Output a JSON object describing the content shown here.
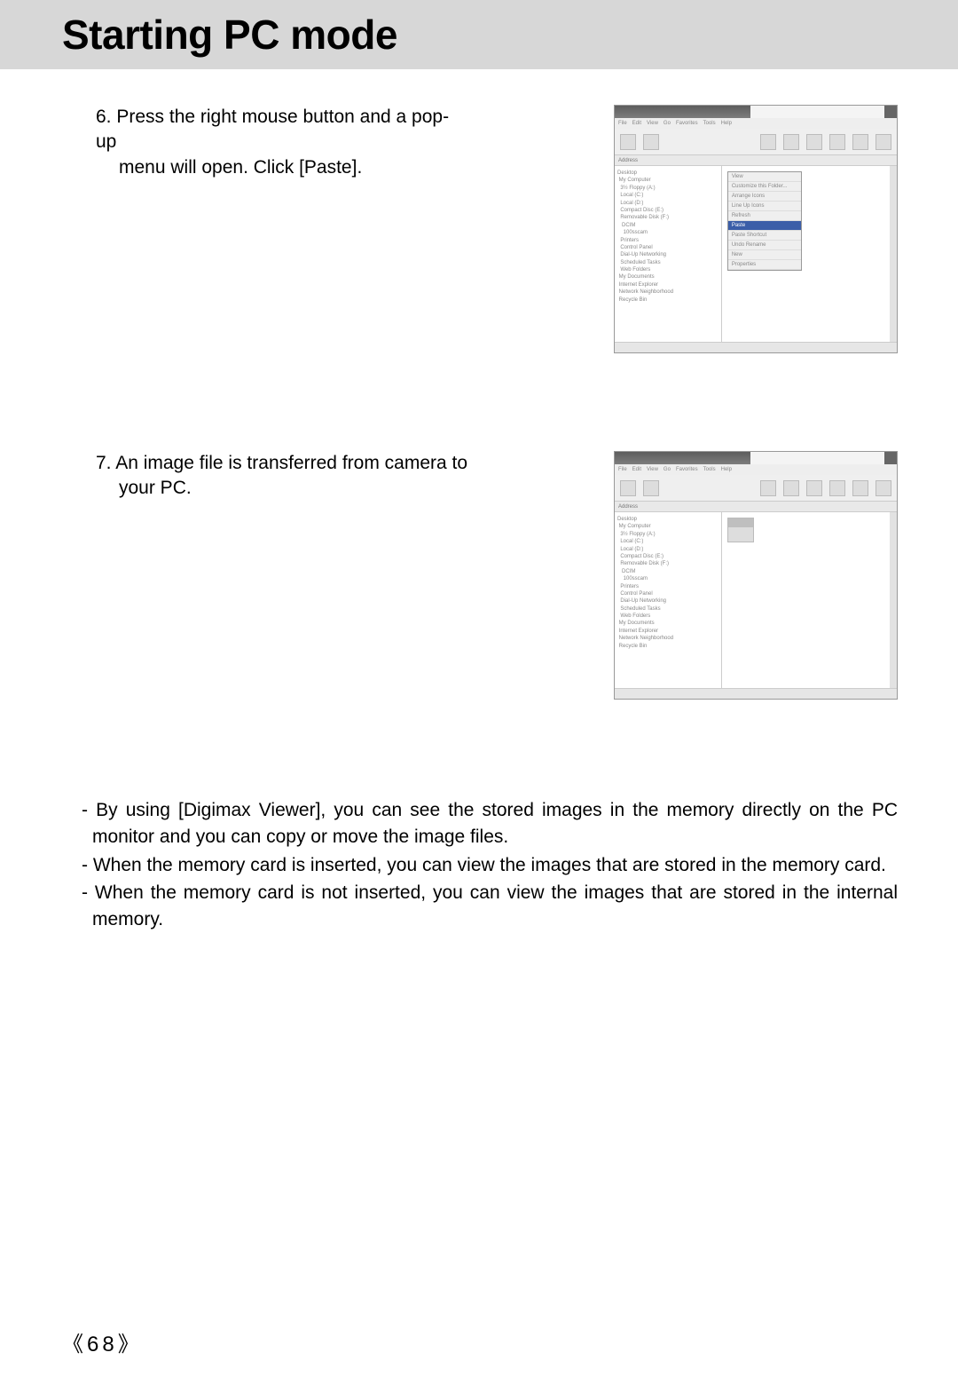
{
  "header": {
    "title": "Starting PC mode"
  },
  "steps": [
    {
      "num": "6.",
      "line1": "Press the right mouse button and a pop-up",
      "line2": "menu will open. Click [Paste].",
      "context_highlight": "Paste"
    },
    {
      "num": "7.",
      "line1": "An image file is transferred from camera to",
      "line2": "your PC."
    }
  ],
  "notes": [
    "- By using [Digimax Viewer], you can see the stored images in the memory directly on the PC monitor and you can copy or move the image files.",
    "- When the memory card is inserted, you can view the images that are stored in the memory card.",
    "- When the memory card is not inserted, you can view the images that are stored in the internal memory."
  ],
  "page_number": {
    "left": "《",
    "value": "68",
    "right": "》"
  }
}
